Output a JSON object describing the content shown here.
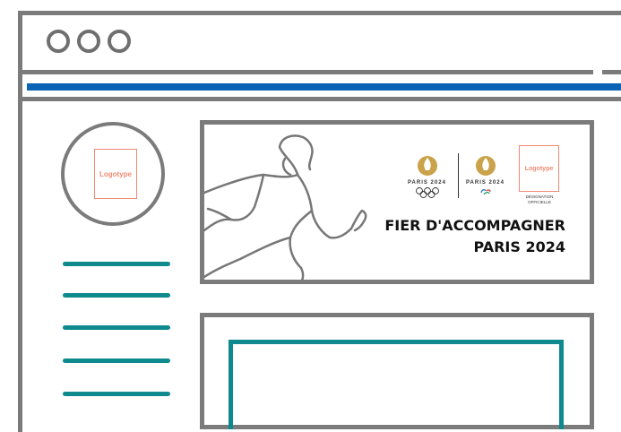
{
  "sidebar": {
    "logo_label": "Logotype"
  },
  "banner": {
    "partner_logo_label": "Logotype",
    "olympic_wordmark": "PARIS 2024",
    "paralympic_wordmark": "PARIS 2024",
    "designation": "DÉSIGNATION OFFICIELLE",
    "slogan_line1": "FIER D'ACCOMPAGNER",
    "slogan_line2": "PARIS 2024"
  },
  "colors": {
    "frame": "#7b7b7b",
    "accent_blue": "#0b63b6",
    "accent_teal": "#0e8a8f",
    "logo_outline": "#f08a73",
    "gold": "#c9a24a"
  }
}
